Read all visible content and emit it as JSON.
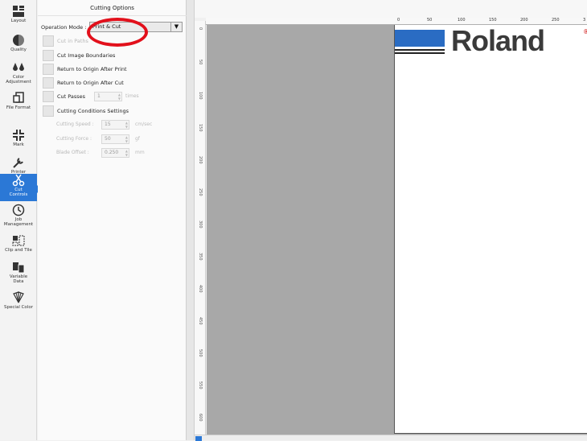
{
  "rail": {
    "items": [
      {
        "label": "Layout",
        "icon": "layout-icon"
      },
      {
        "label": "Quality",
        "icon": "quality-icon"
      },
      {
        "label": "Color\nAdjustment",
        "icon": "color-adjustment-icon"
      },
      {
        "label": "File Format",
        "icon": "file-format-icon"
      },
      {
        "label": "Mark",
        "icon": "mark-icon"
      },
      {
        "label": "Printer\nControls",
        "icon": "printer-controls-icon"
      },
      {
        "label": "Cut\nControls",
        "icon": "scissors-icon"
      },
      {
        "label": "Job\nManagement",
        "icon": "clock-icon"
      },
      {
        "label": "Clip and Tile",
        "icon": "clip-tile-icon"
      },
      {
        "label": "Variable\nData",
        "icon": "variable-data-icon"
      },
      {
        "label": "Special Color",
        "icon": "special-color-icon"
      }
    ]
  },
  "panel": {
    "title": "Cutting Options",
    "operation_mode_label": "Operation Mode :",
    "operation_mode_value": "Print & Cut",
    "options": [
      {
        "label": "Cut in Paths"
      },
      {
        "label": "Cut Image Boundaries"
      },
      {
        "label": "Return to Origin After Print"
      },
      {
        "label": "Return to Origin After Cut"
      },
      {
        "label": "Cut Passes"
      },
      {
        "label": "Cutting Conditions Settings"
      }
    ],
    "cut_passes_value": "1",
    "cut_passes_unit": "times",
    "conditions": [
      {
        "label": "Cutting Speed :",
        "value": "15",
        "unit": "cm/sec"
      },
      {
        "label": "Cutting Force :",
        "value": "50",
        "unit": "gf"
      },
      {
        "label": "Blade Offset :",
        "value": "0.250",
        "unit": "mm"
      }
    ]
  },
  "ruler": {
    "horizontal": [
      "0",
      "50",
      "100",
      "150",
      "200",
      "250",
      "3"
    ],
    "vertical": [
      "0",
      "50",
      "100",
      "150",
      "200",
      "250",
      "300",
      "350",
      "400",
      "450",
      "500",
      "550",
      "600"
    ]
  },
  "media": {
    "logo_text": "Roland",
    "logo_reg": "®"
  },
  "colors": {
    "accent": "#2b78d6",
    "annotation": "#e2101b",
    "canvas": "#a8a8a8"
  }
}
